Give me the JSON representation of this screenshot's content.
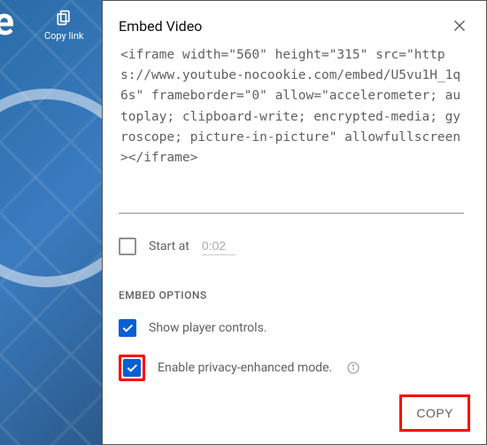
{
  "sideShare": {
    "copyLinkLabel": "Copy link",
    "bgText": "ure"
  },
  "dialog": {
    "title": "Embed Video",
    "embedCode": "<iframe width=\"560\" height=\"315\" src=\"https://www.youtube-nocookie.com/embed/U5vu1H_1q6s\" frameborder=\"0\" allow=\"accelerometer; autoplay; clipboard-write; encrypted-media; gyroscope; picture-in-picture\" allowfullscreen></iframe>",
    "startAt": {
      "label": "Start at",
      "value": "0:02",
      "checked": false
    },
    "sectionTitle": "EMBED OPTIONS",
    "options": {
      "playerControls": {
        "label": "Show player controls.",
        "checked": true
      },
      "privacyMode": {
        "label": "Enable privacy-enhanced mode.",
        "checked": true
      }
    },
    "copyButton": "COPY"
  }
}
